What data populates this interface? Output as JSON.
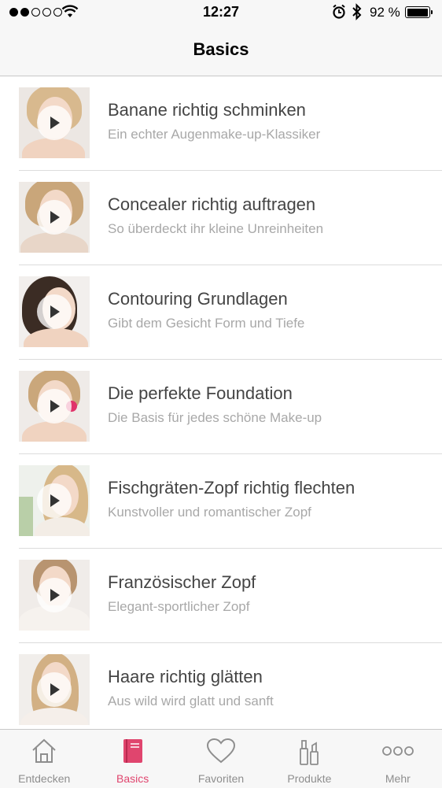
{
  "status_bar": {
    "time": "12:27",
    "battery_percent": "92 %",
    "battery_level": 0.92,
    "signal_bars_filled": 2,
    "signal_bars_total": 5
  },
  "nav": {
    "title": "Basics"
  },
  "list": {
    "items": [
      {
        "title": "Banane richtig schminken",
        "subtitle": "Ein echter Augenmake-up-Klassiker"
      },
      {
        "title": "Concealer richtig auftragen",
        "subtitle": "So überdeckt ihr kleine Unreinheiten"
      },
      {
        "title": "Contouring Grundlagen",
        "subtitle": "Gibt dem Gesicht Form und Tiefe"
      },
      {
        "title": "Die perfekte Foundation",
        "subtitle": "Die Basis für jedes schöne Make-up"
      },
      {
        "title": "Fischgräten-Zopf richtig flechten",
        "subtitle": "Kunstvoller und romantischer Zopf"
      },
      {
        "title": "Französischer Zopf",
        "subtitle": "Elegant-sportlicher Zopf"
      },
      {
        "title": "Haare richtig glätten",
        "subtitle": "Aus wild wird glatt und sanft"
      }
    ]
  },
  "tabs": [
    {
      "label": "Entdecken",
      "icon": "house-icon"
    },
    {
      "label": "Basics",
      "icon": "book-icon",
      "active": true
    },
    {
      "label": "Favoriten",
      "icon": "heart-icon"
    },
    {
      "label": "Produkte",
      "icon": "cosmetics-icon"
    },
    {
      "label": "Mehr",
      "icon": "more-icon"
    }
  ],
  "colors": {
    "accent": "#e0456e",
    "inactive": "#8e8e8e"
  }
}
